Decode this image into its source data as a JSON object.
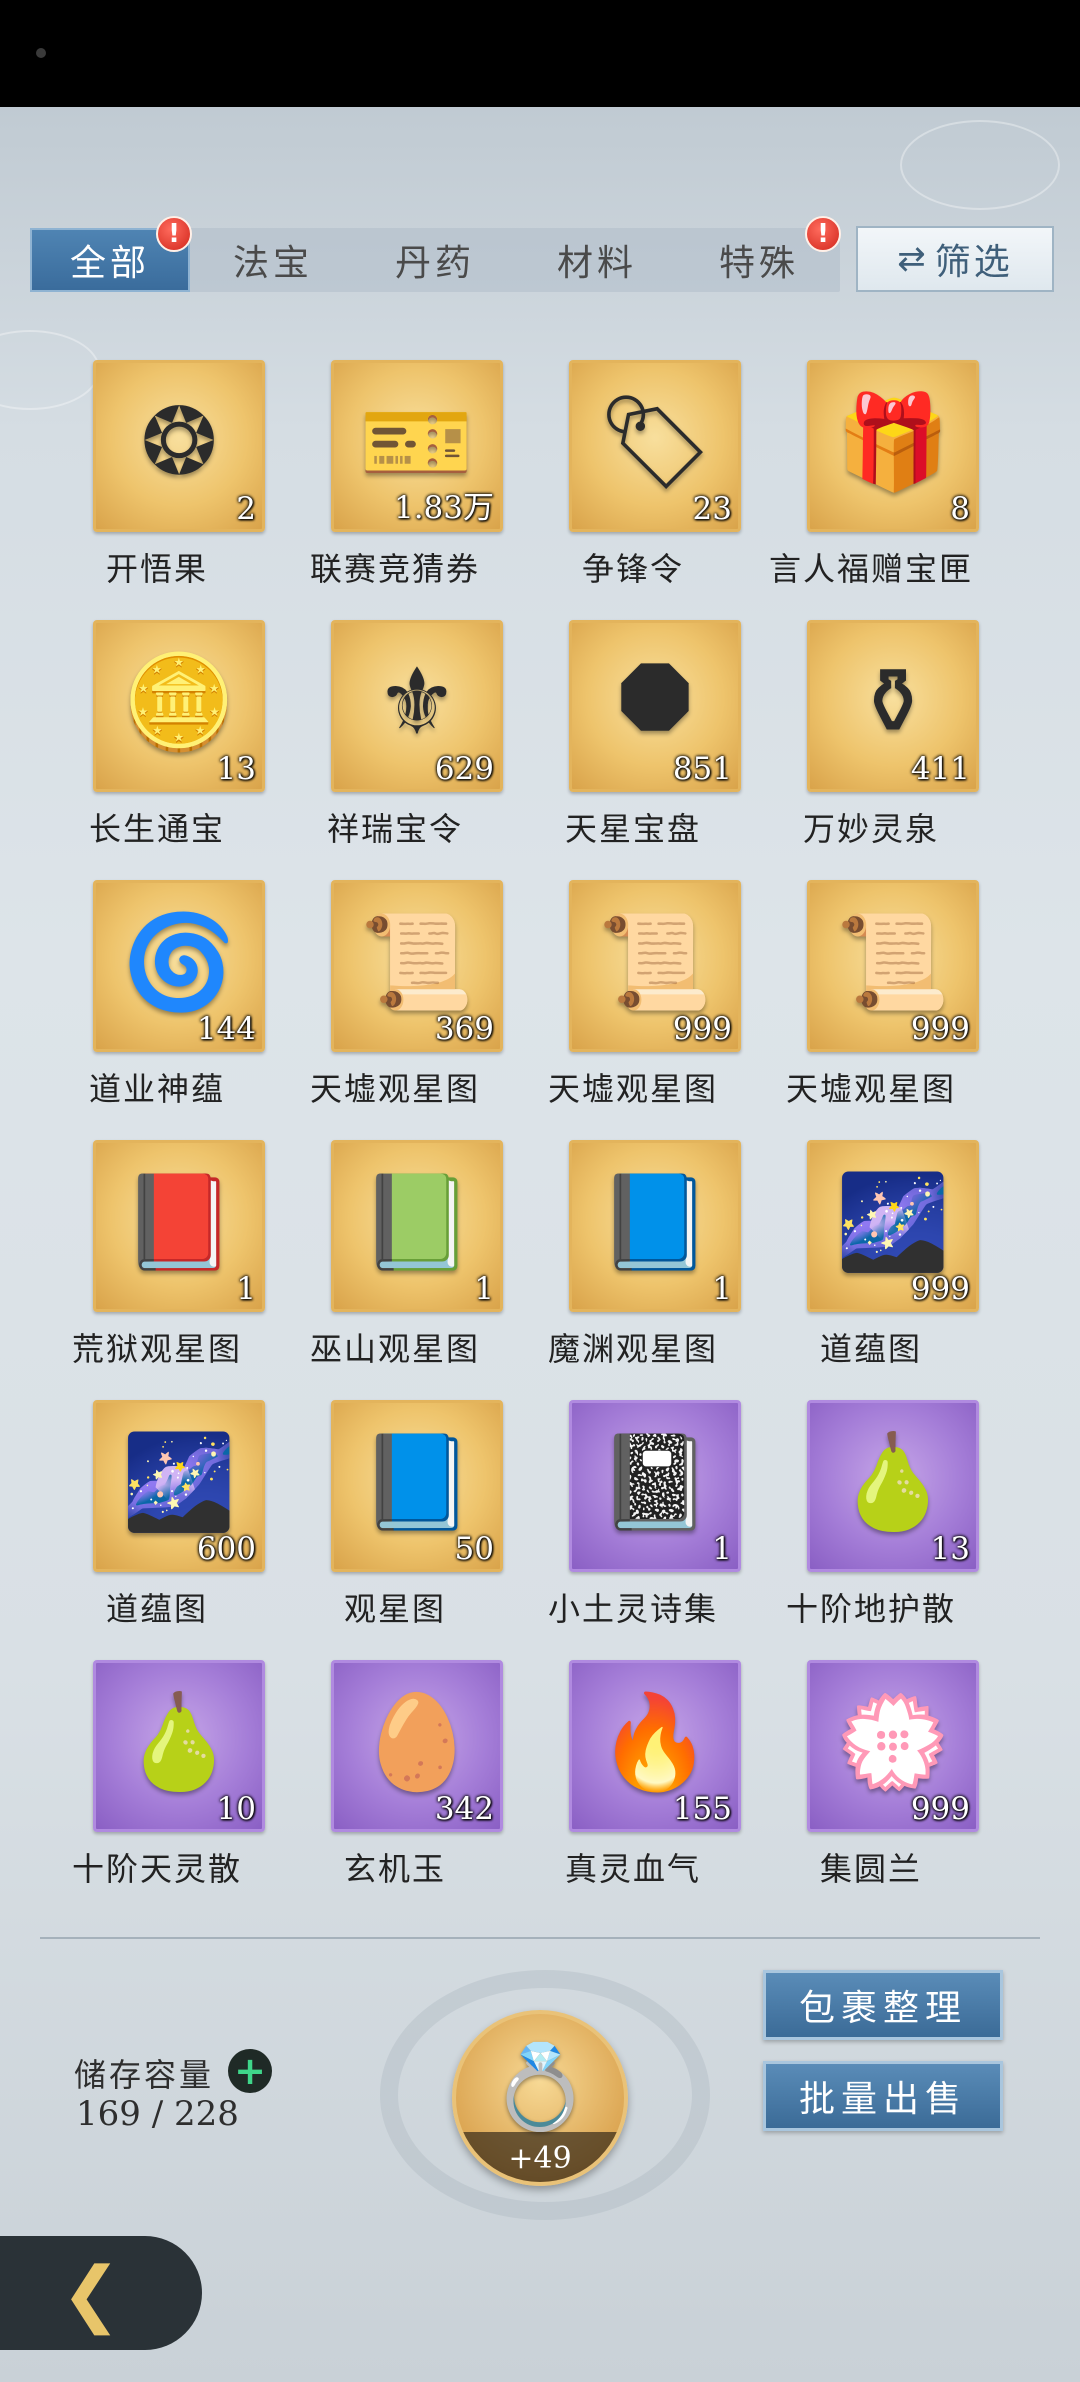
{
  "tabs": [
    {
      "label": "全部",
      "badge": "!"
    },
    {
      "label": "法宝"
    },
    {
      "label": "丹药"
    },
    {
      "label": "材料"
    },
    {
      "label": "特殊",
      "badge": "!"
    }
  ],
  "filter_label": "筛选",
  "items": [
    {
      "name": "开悟果",
      "count": "2",
      "rarity": "gold",
      "icon": "glowing-fruit-icon",
      "glyph": "❂"
    },
    {
      "name": "联赛竞猜券",
      "count": "1.83万",
      "rarity": "gold",
      "icon": "ticket-icon",
      "glyph": "🎫"
    },
    {
      "name": "争锋令",
      "count": "23",
      "rarity": "gold",
      "icon": "token-plaque-icon",
      "glyph": "🏷"
    },
    {
      "name": "言人福赠宝匣",
      "count": "8",
      "rarity": "gold",
      "icon": "treasure-box-icon",
      "glyph": "🎁"
    },
    {
      "name": "长生通宝",
      "count": "13",
      "rarity": "gold",
      "icon": "coin-icon",
      "glyph": "🪙"
    },
    {
      "name": "祥瑞宝令",
      "count": "629",
      "rarity": "gold",
      "icon": "ornate-token-icon",
      "glyph": "⚜"
    },
    {
      "name": "天星宝盘",
      "count": "851",
      "rarity": "gold",
      "icon": "star-disc-icon",
      "glyph": "⯃"
    },
    {
      "name": "万妙灵泉",
      "count": "411",
      "rarity": "gold",
      "icon": "vase-icon",
      "glyph": "⚱"
    },
    {
      "name": "道业神蕴",
      "count": "144",
      "rarity": "gold",
      "icon": "spirit-orb-icon",
      "glyph": "🌀"
    },
    {
      "name": "天墟观星图",
      "count": "369",
      "rarity": "gold",
      "icon": "scroll-icon",
      "glyph": "📜"
    },
    {
      "name": "天墟观星图",
      "count": "999",
      "rarity": "gold",
      "icon": "scroll-icon",
      "glyph": "📜"
    },
    {
      "name": "天墟观星图",
      "count": "999",
      "rarity": "gold",
      "icon": "scroll-icon",
      "glyph": "📜"
    },
    {
      "name": "荒狱观星图",
      "count": "1",
      "rarity": "gold",
      "icon": "red-scroll-icon",
      "glyph": "📕"
    },
    {
      "name": "巫山观星图",
      "count": "1",
      "rarity": "gold",
      "icon": "green-scroll-icon",
      "glyph": "📗"
    },
    {
      "name": "魔渊观星图",
      "count": "1",
      "rarity": "gold",
      "icon": "purple-scroll-icon",
      "glyph": "📘"
    },
    {
      "name": "道蕴图",
      "count": "999",
      "rarity": "gold",
      "icon": "star-chart-icon",
      "glyph": "🌌"
    },
    {
      "name": "道蕴图",
      "count": "600",
      "rarity": "gold",
      "icon": "star-chart-icon",
      "glyph": "🌌"
    },
    {
      "name": "观星图",
      "count": "50",
      "rarity": "gold",
      "icon": "blue-scroll-icon",
      "glyph": "📘"
    },
    {
      "name": "小土灵诗集",
      "count": "1",
      "rarity": "purple",
      "icon": "poetry-book-icon",
      "glyph": "📓"
    },
    {
      "name": "十阶地护散",
      "count": "13",
      "rarity": "purple",
      "icon": "gourd-icon",
      "glyph": "🍐"
    },
    {
      "name": "十阶天灵散",
      "count": "10",
      "rarity": "purple",
      "icon": "gourd-icon",
      "glyph": "🍐"
    },
    {
      "name": "玄机玉",
      "count": "342",
      "rarity": "purple",
      "icon": "jade-stone-icon",
      "glyph": "🥚"
    },
    {
      "name": "真灵血气",
      "count": "155",
      "rarity": "purple",
      "icon": "flame-icon",
      "glyph": "🔥"
    },
    {
      "name": "集圆兰",
      "count": "999",
      "rarity": "purple",
      "icon": "orchid-flower-icon",
      "glyph": "💮"
    }
  ],
  "storage": {
    "label": "储存容量",
    "value": "169 / 228"
  },
  "featured": {
    "count": "+49",
    "icon": "purple-ring-icon",
    "glyph": "💍"
  },
  "buttons": {
    "organize": "包裹整理",
    "bulk_sell": "批量出售"
  },
  "colors": {
    "gold_tile": "#eec46c",
    "purple_tile": "#a57ed8",
    "active_tab": "#3f78a8",
    "badge": "#d1261b"
  }
}
